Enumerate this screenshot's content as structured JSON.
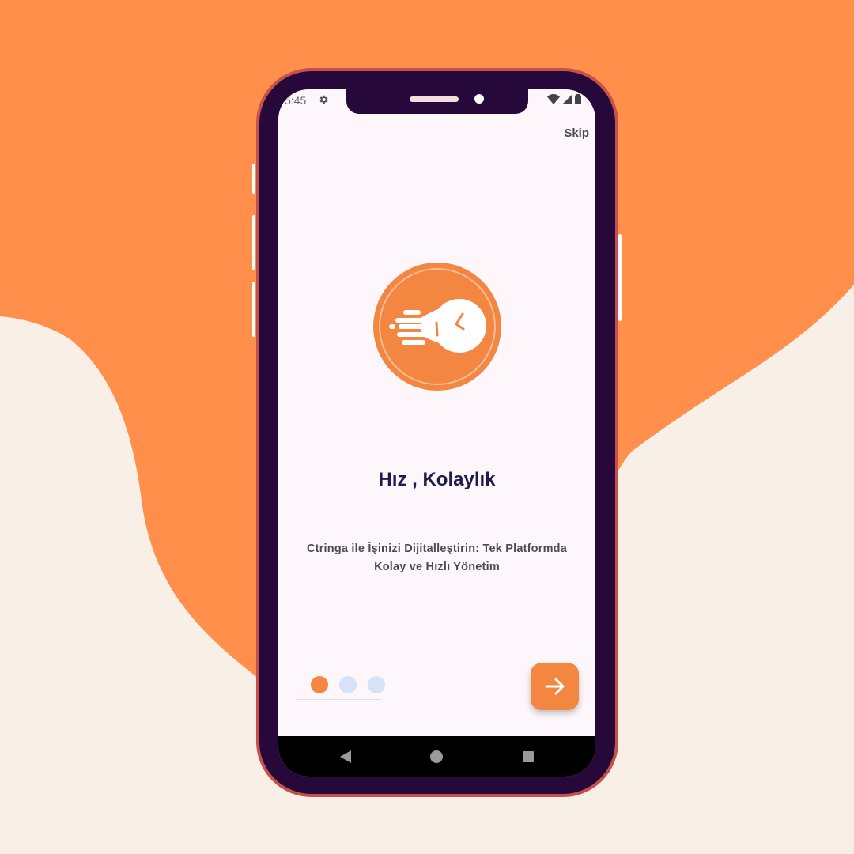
{
  "colors": {
    "background": "#f8f0e7",
    "blob": "#ff8f4a",
    "accent": "#f38741",
    "phone_frame": "#26083a",
    "phone_border": "#c4524a",
    "dot_active": "#f38741",
    "dot_inactive": "#d6e2f5",
    "title": "#1f1b4b"
  },
  "status_bar": {
    "time": "5:45",
    "icons": [
      "gear-icon",
      "wifi-icon",
      "signal-icon",
      "battery-icon"
    ]
  },
  "header": {
    "skip_label": "Skip"
  },
  "onboarding": {
    "logo_icon": "stopwatch-speed-icon",
    "title": "Hız , Kolaylık",
    "description": "Ctringa ile İşinizi Dijitalleştirin: Tek Platformda Kolay ve Hızlı Yönetim",
    "page_indicator": {
      "total": 3,
      "active": 1
    },
    "next_button_icon": "arrow-right-icon"
  },
  "navigation_bar": {
    "buttons": [
      "back-icon",
      "home-icon",
      "recents-icon"
    ]
  }
}
